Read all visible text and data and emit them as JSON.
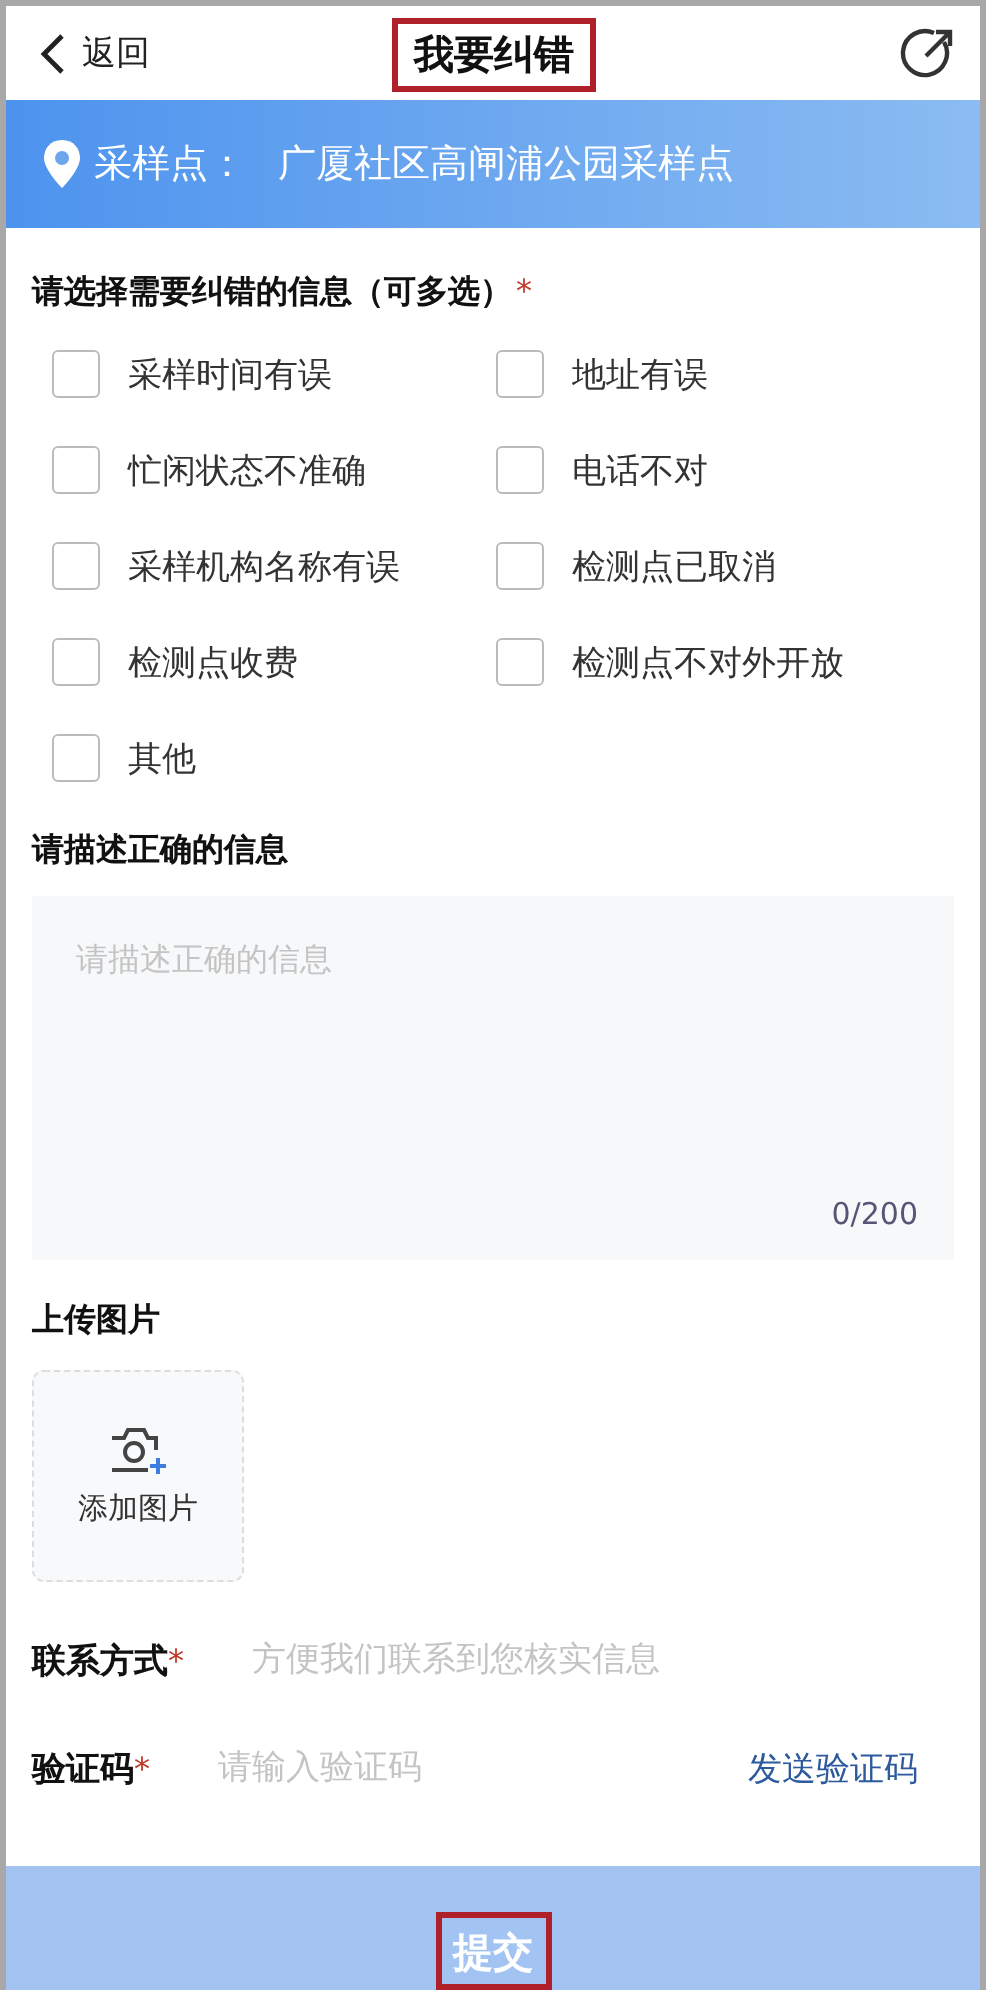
{
  "header": {
    "back": {
      "label": "返回"
    },
    "title": "我要纠错",
    "title_highlighted": true
  },
  "banner": {
    "label": "采样点：",
    "value": "广厦社区高闸浦公园采样点"
  },
  "options": {
    "title": "请选择需要纠错的信息（可多选）",
    "required_mark": "*",
    "items": [
      {
        "label": "采样时间有误",
        "checked": false
      },
      {
        "label": "地址有误",
        "checked": false
      },
      {
        "label": "忙闲状态不准确",
        "checked": false
      },
      {
        "label": "电话不对",
        "checked": false
      },
      {
        "label": "采样机构名称有误",
        "checked": false
      },
      {
        "label": "检测点已取消",
        "checked": false
      },
      {
        "label": "检测点收费",
        "checked": false
      },
      {
        "label": "检测点不对外开放",
        "checked": false
      },
      {
        "label": "其他",
        "checked": false
      }
    ]
  },
  "description": {
    "title": "请描述正确的信息",
    "placeholder": "请描述正确的信息",
    "counter": "0/200"
  },
  "upload": {
    "title": "上传图片",
    "button": "添加图片"
  },
  "fields": [
    {
      "label": "联系方式",
      "required_mark": "*",
      "placeholder": "方便我们联系到您核实信息"
    },
    {
      "label": "验证码",
      "required_mark": "*",
      "placeholder": "请输入验证码",
      "action": "发送验证码"
    }
  ],
  "submit": {
    "label": "提交",
    "highlighted": true
  }
}
